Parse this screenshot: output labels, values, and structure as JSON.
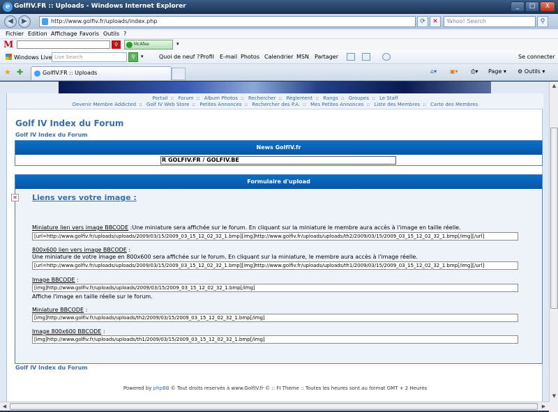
{
  "window": {
    "title": "GolfIV.FR :: Uploads - Windows Internet Explorer",
    "minimize": "_",
    "maximize": "□",
    "close": "X"
  },
  "address_bar": {
    "url": "http://www.golfiv.fr/uploads/index.php",
    "search_placeholder": "Yahoo! Search"
  },
  "menu": [
    "Fichier",
    "Edition",
    "Affichage",
    "Favoris",
    "Outils",
    "?"
  ],
  "mcafee": {
    "logo": "M",
    "badge": "McAfee SiteAdvisor"
  },
  "windows_live": {
    "brand": "Windows Live",
    "search_placeholder": "Live Search",
    "links": [
      "Quoi de neuf ?",
      "Profil",
      "E-mail",
      "Photos",
      "Calendrier",
      "MSN",
      "Partager"
    ],
    "signin": "Se connecter"
  },
  "tabs": [
    {
      "label": "GolfIV.FR :: Uploads"
    }
  ],
  "command_bar": {
    "page": "Page",
    "tools": "Outils"
  },
  "forum": {
    "nav_row1": [
      "Portail",
      "Forum",
      "Album Photos",
      "Rechercher",
      "Règlement",
      "Rangs",
      "Groupes",
      "Le Staff"
    ],
    "nav_row2": [
      "Devenir Membre Addicted",
      "Golf IV Web Store",
      "Petites Annonces",
      "Rechercher des P.A.",
      "Mes Petites Annonces",
      "Liste des Membres",
      "Carte des Membres"
    ],
    "title": "Golf IV Index du Forum",
    "breadcrumb": "Golf IV Index du Forum",
    "news": {
      "heading": "News GolfIV.fr",
      "ticker": "R GOLFIV.FR / GOLFIV.BE"
    },
    "upload": {
      "heading": "Formulaire d'upload",
      "links_title": "Liens vers votre image :",
      "fields": [
        {
          "label": "Miniature lien vers image BBCODE",
          "desc": " :Une miniature sera affichée sur le forum. En cliquant sur la miniature le membre aura accès à l'image en taille réelle.",
          "value": "[url=http://www.golfiv.fr/uploads/uploads/2009/03/15/2009_03_15_12_02_32_1.bmp][img]http://www.golfiv.fr/uploads/uploads/th2/2009/03/15/2009_03_15_12_02_32_1.bmp[/img][/url]"
        },
        {
          "label": "800x600 lien vers image BBCODE",
          "desc": "Une miniature de votre image en 800x600 sera affichée sur le forum. En cliquant sur la miniature, le membre aura accès à l'image réelle.",
          "value": "[url=http://www.golfiv.fr/uploads/uploads/2009/03/15/2009_03_15_12_02_32_1.bmp][img]http://www.golfiv.fr/uploads/uploads/th1/2009/03/15/2009_03_15_12_02_32_1.bmp[/img][/url]"
        },
        {
          "label": "Image BBCODE",
          "desc": "Affiche l'image en taille réelle sur le forum.",
          "value": "[img]http://www.golfiv.fr/uploads/uploads/2009/03/15/2009_03_15_12_02_32_1.bmp[/img]"
        },
        {
          "label": "Miniature BBCODE",
          "value": "[img]http://www.golfiv.fr/uploads/uploads/th2/2009/03/15/2009_03_15_12_02_32_1.bmp[/img]"
        },
        {
          "label": "Image 800x600 BBCODE",
          "value": "[img]http://www.golfiv.fr/uploads/uploads/th1/2009/03/15/2009_03_15_12_02_32_1.bmp[/img]"
        }
      ]
    },
    "footer_link": "Golf IV Index du Forum",
    "copyright": {
      "prefix": "Powered by ",
      "phpbb": "phpBB",
      "rest": " © Tout droits reservés à www.GolfIV.fr © :: FI Theme :: Toutes les heures sont au format GMT + 2 Heures"
    }
  }
}
